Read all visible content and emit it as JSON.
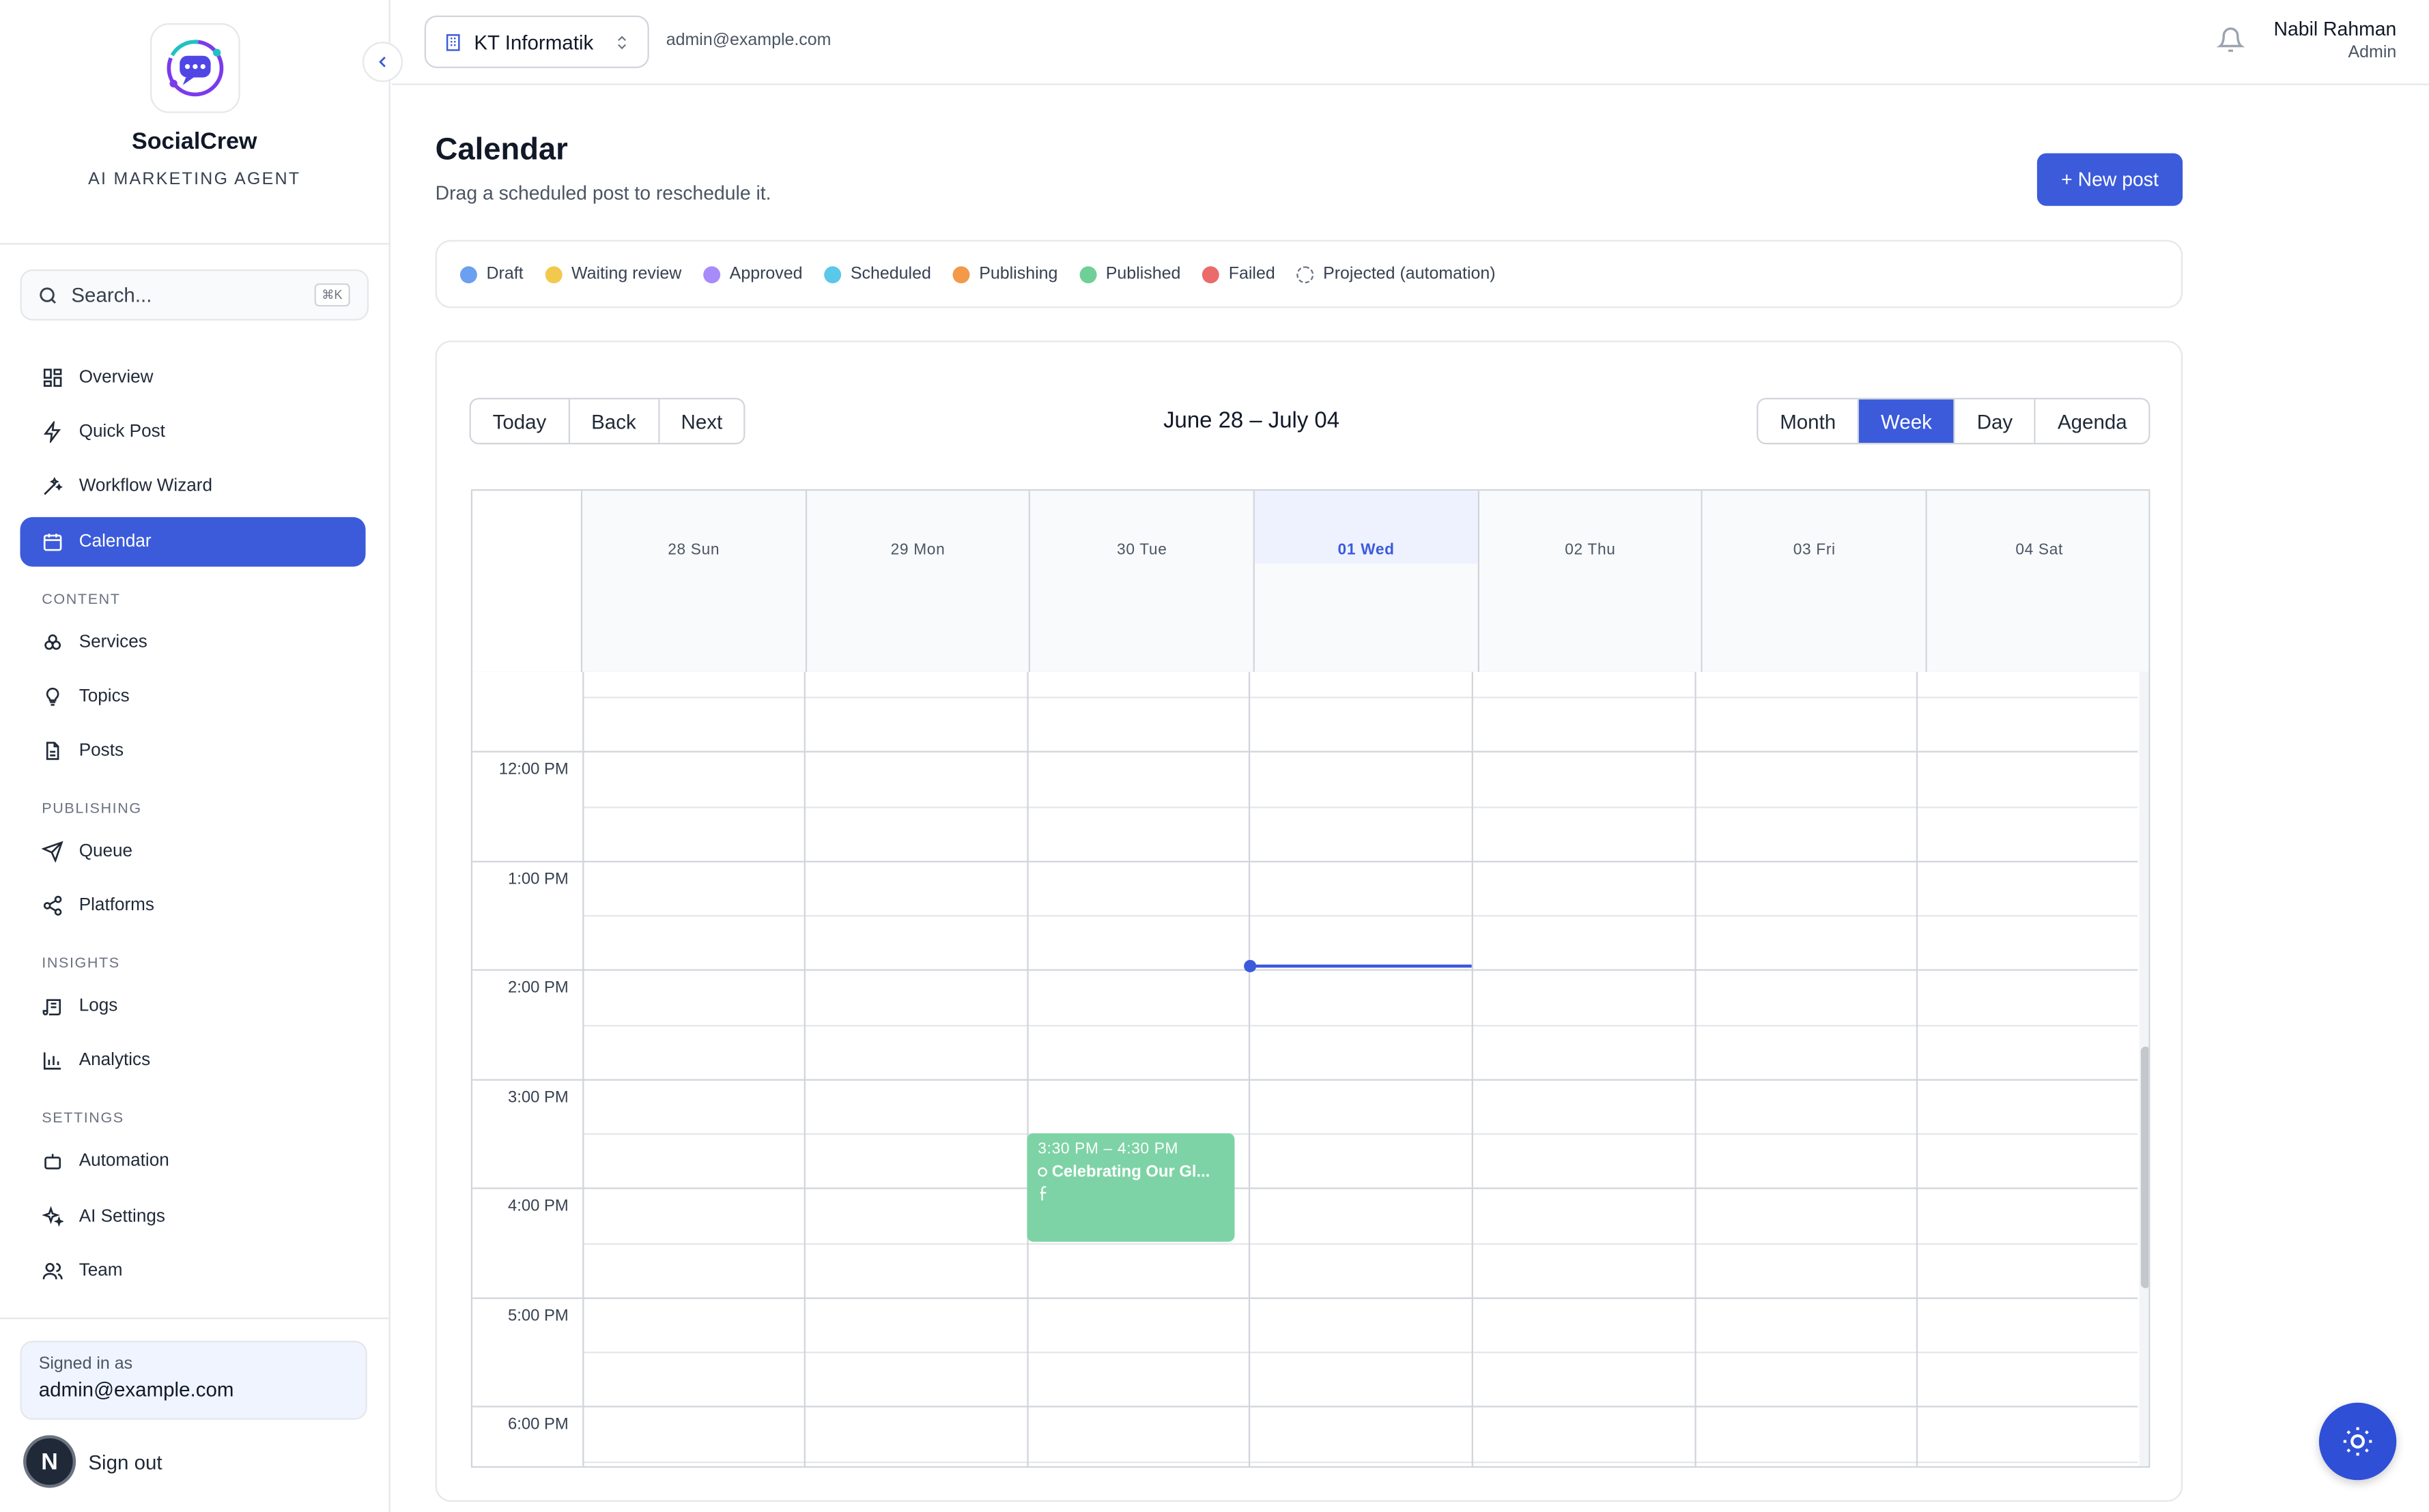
{
  "brand": {
    "name": "SocialCrew",
    "tagline": "AI MARKETING AGENT"
  },
  "search": {
    "placeholder": "Search...",
    "shortcut": "⌘K"
  },
  "nav": {
    "main": [
      {
        "label": "Overview",
        "icon": "grid-icon"
      },
      {
        "label": "Quick Post",
        "icon": "lightning-icon"
      },
      {
        "label": "Workflow Wizard",
        "icon": "wand-icon"
      },
      {
        "label": "Calendar",
        "icon": "calendar-icon",
        "active": true
      }
    ],
    "content_label": "CONTENT",
    "content": [
      {
        "label": "Services",
        "icon": "boxes-icon"
      },
      {
        "label": "Topics",
        "icon": "lightbulb-icon"
      },
      {
        "label": "Posts",
        "icon": "document-icon"
      }
    ],
    "publishing_label": "PUBLISHING",
    "publishing": [
      {
        "label": "Queue",
        "icon": "send-icon"
      },
      {
        "label": "Platforms",
        "icon": "share-icon"
      }
    ],
    "insights_label": "INSIGHTS",
    "insights": [
      {
        "label": "Logs",
        "icon": "scroll-icon"
      },
      {
        "label": "Analytics",
        "icon": "bar-chart-icon"
      }
    ],
    "settings_label": "SETTINGS",
    "settings": [
      {
        "label": "Automation",
        "icon": "bot-icon"
      },
      {
        "label": "AI Settings",
        "icon": "sparkles-icon"
      },
      {
        "label": "Team",
        "icon": "users-icon"
      }
    ]
  },
  "account": {
    "signed_in_label": "Signed in as",
    "email": "admin@example.com",
    "signout": "Sign out",
    "avatar_letter": "N"
  },
  "topbar": {
    "org": "KT Informatik",
    "email": "admin@example.com",
    "user_name": "Nabil Rahman",
    "user_role": "Admin"
  },
  "page": {
    "title": "Calendar",
    "subtitle": "Drag a scheduled post to reschedule it.",
    "new_post": "+ New post"
  },
  "legend": [
    {
      "label": "Draft",
      "color": "#6b9ff0"
    },
    {
      "label": "Waiting review",
      "color": "#f2c94c"
    },
    {
      "label": "Approved",
      "color": "#a78bfa"
    },
    {
      "label": "Scheduled",
      "color": "#5ac8e8"
    },
    {
      "label": "Publishing",
      "color": "#f2994a"
    },
    {
      "label": "Published",
      "color": "#6fcf97"
    },
    {
      "label": "Failed",
      "color": "#eb6b6b"
    },
    {
      "label": "Projected (automation)",
      "color": "dashed"
    }
  ],
  "toolbar": {
    "today": "Today",
    "back": "Back",
    "next": "Next",
    "range": "June 28 – July 04",
    "views": [
      "Month",
      "Week",
      "Day",
      "Agenda"
    ],
    "active_view": "Week"
  },
  "days": [
    "28 Sun",
    "29 Mon",
    "30 Tue",
    "01 Wed",
    "02 Thu",
    "03 Fri",
    "04 Sat"
  ],
  "today_index": 3,
  "times": [
    "12:00 PM",
    "1:00 PM",
    "2:00 PM",
    "3:00 PM",
    "4:00 PM",
    "5:00 PM",
    "6:00 PM"
  ],
  "event": {
    "time": "3:30 PM – 4:30 PM",
    "title": "Celebrating Our Gl...",
    "day": "30 Tue",
    "status_color": "#7dd3a5",
    "platform_icon": "facebook-icon"
  },
  "colors": {
    "accent": "#3b5bdb"
  }
}
